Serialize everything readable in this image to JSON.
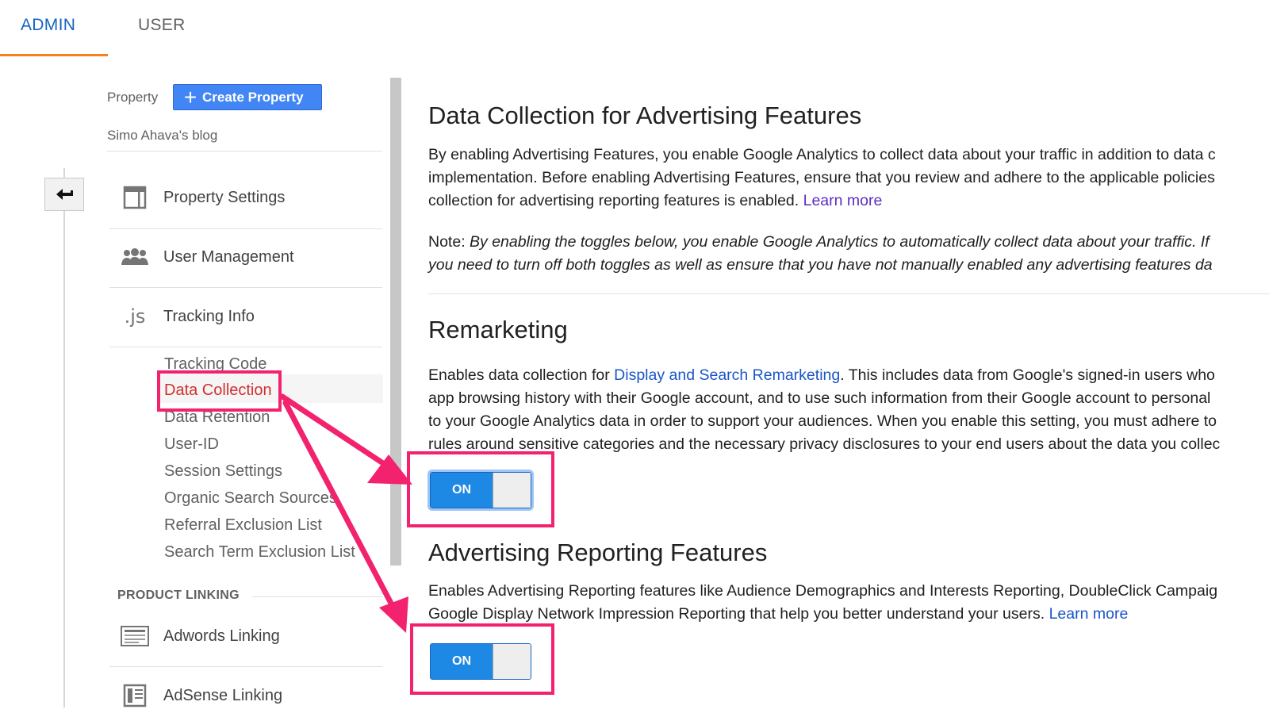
{
  "tabs": {
    "admin": "ADMIN",
    "user": "USER"
  },
  "sidebar": {
    "property_label": "Property",
    "create_button": "Create Property",
    "property_name": "Simo Ahava's blog",
    "items": [
      {
        "label": "Property Settings",
        "icon": "property-settings-icon"
      },
      {
        "label": "User Management",
        "icon": "users-icon"
      },
      {
        "label": "Tracking Info",
        "icon": "js-icon"
      }
    ],
    "subitems": [
      "Tracking Code",
      "Data Collection",
      "Data Retention",
      "User-ID",
      "Session Settings",
      "Organic Search Sources",
      "Referral Exclusion List",
      "Search Term Exclusion List"
    ],
    "active_subitem": "Data Collection",
    "product_linking_label": "PRODUCT LINKING",
    "linking_items": [
      {
        "label": "Adwords Linking",
        "icon": "adwords-icon"
      },
      {
        "label": "AdSense Linking",
        "icon": "adsense-icon"
      }
    ]
  },
  "main": {
    "title": "Data Collection for Advertising Features",
    "intro_lines": [
      "By enabling Advertising Features, you enable Google Analytics to collect data about your traffic in addition to data c",
      "implementation. Before enabling Advertising Features, ensure that you review and adhere to the applicable policies"
    ],
    "intro_line3": "collection for advertising reporting features is enabled.",
    "intro_link": "Learn more",
    "note_label": "Note:",
    "note_line1": "By enabling the toggles below, you enable Google Analytics to automatically collect data about your traffic. If",
    "note_line2": "you need to turn off both toggles as well as ensure that you have not manually enabled any advertising features da",
    "remarketing": {
      "title": "Remarketing",
      "line1_pre": "Enables data collection for",
      "line1_link": "Display and Search Remarketing",
      "line1_post": ". This includes data from Google's signed-in users who",
      "line2": "app browsing history with their Google account, and to use such information from their Google account to personal",
      "line3": "to your Google Analytics data in order to support your audiences. When you enable this setting, you must adhere to",
      "line4": "rules around sensitive categories and the necessary privacy disclosures to your end users about the data you collec",
      "toggle_label": "ON"
    },
    "advertising_reporting": {
      "title": "Advertising Reporting Features",
      "line1": "Enables Advertising Reporting features like Audience Demographics and Interests Reporting, DoubleClick Campaig",
      "line2": "Google Display Network Impression Reporting that help you better understand your users.",
      "link": "Learn more",
      "toggle_label": "ON"
    }
  },
  "colors": {
    "accent_tab": "#f4811f",
    "link": "#1a55c8",
    "annotation": "#f2226f",
    "toggle_on": "#1e88e5"
  }
}
